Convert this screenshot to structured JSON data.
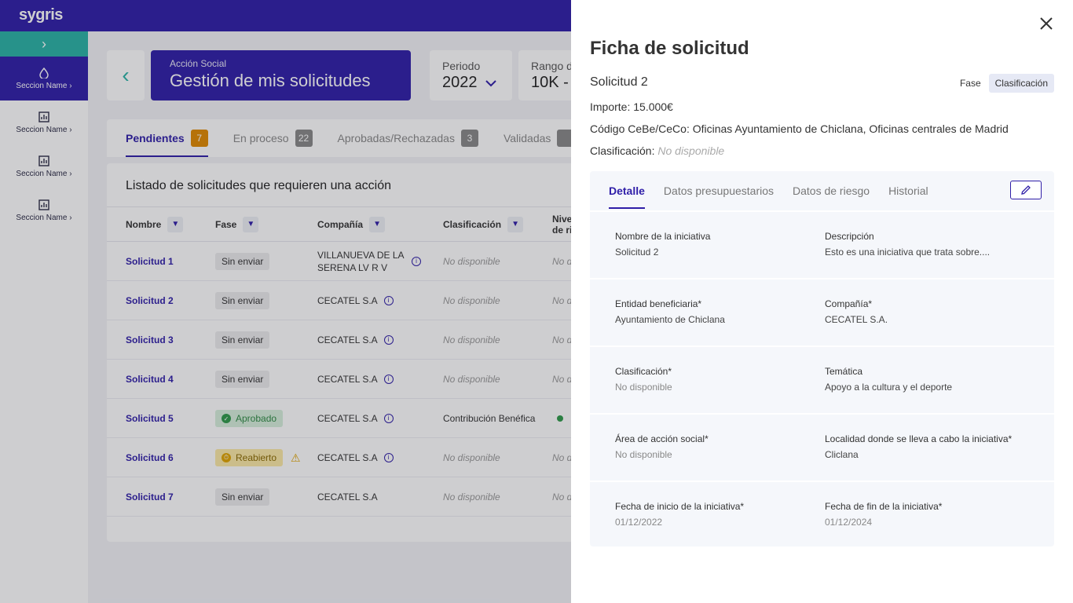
{
  "app": {
    "logo": "sygris"
  },
  "sidebar": {
    "items": [
      {
        "label": "Seccion Name",
        "icon": "drop-icon"
      },
      {
        "label": "Seccion Name",
        "icon": "bar-chart-icon"
      },
      {
        "label": "Seccion Name",
        "icon": "bar-chart-icon"
      },
      {
        "label": "Seccion Name",
        "icon": "bar-chart-icon"
      }
    ]
  },
  "header": {
    "subtitle": "Acción Social",
    "title": "Gestión de mis solicitudes"
  },
  "filters": {
    "periodo": {
      "label": "Periodo",
      "value": "2022"
    },
    "rango": {
      "label": "Rango d",
      "value": "10K -"
    }
  },
  "tabs": [
    {
      "label": "Pendientes",
      "count": "7"
    },
    {
      "label": "En proceso",
      "count": "22"
    },
    {
      "label": "Aprobadas/Rechazadas",
      "count": "3"
    },
    {
      "label": "Validadas",
      "count": ""
    }
  ],
  "list": {
    "title": "Listado de solicitudes que requieren una acción",
    "columns": {
      "nombre": "Nombre",
      "fase": "Fase",
      "compania": "Compañía",
      "clasificacion": "Clasificación",
      "nivel_a": "Nive",
      "nivel_b": "de ri"
    },
    "rows": [
      {
        "nombre": "Solicitud 1",
        "fase": "Sin enviar",
        "compania": "VILLANUEVA DE LA SERENA LV R V",
        "clasificacion": "No disponible",
        "nivel": "No d"
      },
      {
        "nombre": "Solicitud 2",
        "fase": "Sin enviar",
        "compania": "CECATEL S.A",
        "clasificacion": "No disponible",
        "nivel": "No d"
      },
      {
        "nombre": "Solicitud 3",
        "fase": "Sin enviar",
        "compania": "CECATEL S.A",
        "clasificacion": "No disponible",
        "nivel": "No d"
      },
      {
        "nombre": "Solicitud 4",
        "fase": "Sin enviar",
        "compania": "CECATEL S.A",
        "clasificacion": "No disponible",
        "nivel": "No d"
      },
      {
        "nombre": "Solicitud 5",
        "fase": "Aprobado",
        "compania": "CECATEL S.A",
        "clasificacion": "Contribución Benéfica",
        "nivel": ""
      },
      {
        "nombre": "Solicitud 6",
        "fase": "Reabierto",
        "compania": "CECATEL S.A",
        "clasificacion": "No disponible",
        "nivel": "No d"
      },
      {
        "nombre": "Solicitud 7",
        "fase": "Sin enviar",
        "compania": "CECATEL S.A",
        "clasificacion": "No disponible",
        "nivel": "No d"
      }
    ]
  },
  "drawer": {
    "title": "Ficha de solicitud",
    "subtitle": "Solicitud 2",
    "fase_label": "Fase",
    "fase_value": "Clasificación",
    "importe": "Importe: 15.000€",
    "codigo": "Código CeBe/CeCo: Oficinas Ayuntamiento de Chiclana, Oficinas centrales de Madrid",
    "clasificacion_label": "Clasificación:",
    "clasificacion_value": "No disponible",
    "tabs": [
      "Detalle",
      "Datos presupuestarios",
      "Datos de riesgo",
      "Historial"
    ],
    "fields": [
      {
        "k1": "Nombre de la iniciativa",
        "v1": "Solicitud 2",
        "k2": "Descripción",
        "v2": "Esto es una iniciativa que trata sobre...."
      },
      {
        "k1": "Entidad beneficiaria*",
        "v1": "Ayuntamiento de Chiclana",
        "k2": "Compañía*",
        "v2": "CECATEL S.A."
      },
      {
        "k1": "Clasificación*",
        "v1": "No disponible",
        "k2": "Temática",
        "v2": "Apoyo a la cultura y el deporte"
      },
      {
        "k1": "Área de acción social*",
        "v1": "No disponible",
        "k2": "Localidad donde se lleva a cabo la iniciativa*",
        "v2": "Cliclana"
      },
      {
        "k1": "Fecha de inicio de la iniciativa*",
        "v1": "01/12/2022",
        "k2": "Fecha de fin de la iniciativa*",
        "v2": "01/12/2024"
      }
    ]
  }
}
